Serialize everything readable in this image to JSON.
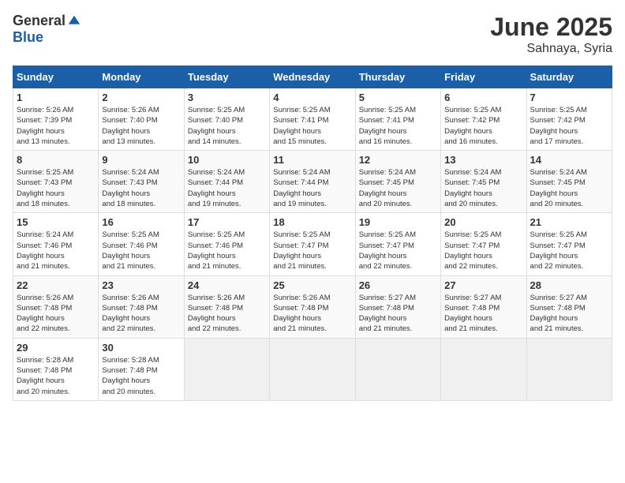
{
  "header": {
    "logo_general": "General",
    "logo_blue": "Blue",
    "month": "June 2025",
    "location": "Sahnaya, Syria"
  },
  "weekdays": [
    "Sunday",
    "Monday",
    "Tuesday",
    "Wednesday",
    "Thursday",
    "Friday",
    "Saturday"
  ],
  "weeks": [
    [
      {
        "day": 1,
        "sunrise": "5:26 AM",
        "sunset": "7:39 PM",
        "daylight": "14 hours and 13 minutes."
      },
      {
        "day": 2,
        "sunrise": "5:26 AM",
        "sunset": "7:40 PM",
        "daylight": "14 hours and 13 minutes."
      },
      {
        "day": 3,
        "sunrise": "5:25 AM",
        "sunset": "7:40 PM",
        "daylight": "14 hours and 14 minutes."
      },
      {
        "day": 4,
        "sunrise": "5:25 AM",
        "sunset": "7:41 PM",
        "daylight": "14 hours and 15 minutes."
      },
      {
        "day": 5,
        "sunrise": "5:25 AM",
        "sunset": "7:41 PM",
        "daylight": "14 hours and 16 minutes."
      },
      {
        "day": 6,
        "sunrise": "5:25 AM",
        "sunset": "7:42 PM",
        "daylight": "14 hours and 16 minutes."
      },
      {
        "day": 7,
        "sunrise": "5:25 AM",
        "sunset": "7:42 PM",
        "daylight": "14 hours and 17 minutes."
      }
    ],
    [
      {
        "day": 8,
        "sunrise": "5:25 AM",
        "sunset": "7:43 PM",
        "daylight": "14 hours and 18 minutes."
      },
      {
        "day": 9,
        "sunrise": "5:24 AM",
        "sunset": "7:43 PM",
        "daylight": "14 hours and 18 minutes."
      },
      {
        "day": 10,
        "sunrise": "5:24 AM",
        "sunset": "7:44 PM",
        "daylight": "14 hours and 19 minutes."
      },
      {
        "day": 11,
        "sunrise": "5:24 AM",
        "sunset": "7:44 PM",
        "daylight": "14 hours and 19 minutes."
      },
      {
        "day": 12,
        "sunrise": "5:24 AM",
        "sunset": "7:45 PM",
        "daylight": "14 hours and 20 minutes."
      },
      {
        "day": 13,
        "sunrise": "5:24 AM",
        "sunset": "7:45 PM",
        "daylight": "14 hours and 20 minutes."
      },
      {
        "day": 14,
        "sunrise": "5:24 AM",
        "sunset": "7:45 PM",
        "daylight": "14 hours and 20 minutes."
      }
    ],
    [
      {
        "day": 15,
        "sunrise": "5:24 AM",
        "sunset": "7:46 PM",
        "daylight": "14 hours and 21 minutes."
      },
      {
        "day": 16,
        "sunrise": "5:25 AM",
        "sunset": "7:46 PM",
        "daylight": "14 hours and 21 minutes."
      },
      {
        "day": 17,
        "sunrise": "5:25 AM",
        "sunset": "7:46 PM",
        "daylight": "14 hours and 21 minutes."
      },
      {
        "day": 18,
        "sunrise": "5:25 AM",
        "sunset": "7:47 PM",
        "daylight": "14 hours and 21 minutes."
      },
      {
        "day": 19,
        "sunrise": "5:25 AM",
        "sunset": "7:47 PM",
        "daylight": "14 hours and 22 minutes."
      },
      {
        "day": 20,
        "sunrise": "5:25 AM",
        "sunset": "7:47 PM",
        "daylight": "14 hours and 22 minutes."
      },
      {
        "day": 21,
        "sunrise": "5:25 AM",
        "sunset": "7:47 PM",
        "daylight": "14 hours and 22 minutes."
      }
    ],
    [
      {
        "day": 22,
        "sunrise": "5:26 AM",
        "sunset": "7:48 PM",
        "daylight": "14 hours and 22 minutes."
      },
      {
        "day": 23,
        "sunrise": "5:26 AM",
        "sunset": "7:48 PM",
        "daylight": "14 hours and 22 minutes."
      },
      {
        "day": 24,
        "sunrise": "5:26 AM",
        "sunset": "7:48 PM",
        "daylight": "14 hours and 22 minutes."
      },
      {
        "day": 25,
        "sunrise": "5:26 AM",
        "sunset": "7:48 PM",
        "daylight": "14 hours and 21 minutes."
      },
      {
        "day": 26,
        "sunrise": "5:27 AM",
        "sunset": "7:48 PM",
        "daylight": "14 hours and 21 minutes."
      },
      {
        "day": 27,
        "sunrise": "5:27 AM",
        "sunset": "7:48 PM",
        "daylight": "14 hours and 21 minutes."
      },
      {
        "day": 28,
        "sunrise": "5:27 AM",
        "sunset": "7:48 PM",
        "daylight": "14 hours and 21 minutes."
      }
    ],
    [
      {
        "day": 29,
        "sunrise": "5:28 AM",
        "sunset": "7:48 PM",
        "daylight": "14 hours and 20 minutes."
      },
      {
        "day": 30,
        "sunrise": "5:28 AM",
        "sunset": "7:48 PM",
        "daylight": "14 hours and 20 minutes."
      },
      null,
      null,
      null,
      null,
      null
    ]
  ]
}
